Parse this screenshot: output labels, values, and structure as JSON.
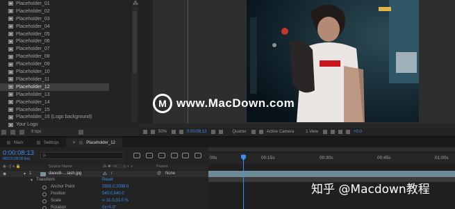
{
  "project": {
    "items": [
      "Placeholder_01",
      "Placeholder_02",
      "Placeholder_03",
      "Placeholder_04",
      "Placeholder_05",
      "Placeholder_06",
      "Placeholder_07",
      "Placeholder_08",
      "Placeholder_09",
      "Placeholder_10",
      "Placeholder_11",
      "Placeholder_12",
      "Placeholder_13",
      "Placeholder_14",
      "Placeholder_15",
      "Placeholder_16 (Logo background)",
      "Your Logo"
    ],
    "selected_index": 11,
    "bpc": "8 bpc",
    "flowchart_glyph": "⁂"
  },
  "viewer_footer": {
    "zoom": "50%",
    "timecode": "0:00:08:13",
    "resolution": "Quarter",
    "camera": "Active Camera",
    "view": "1 View",
    "exposure": "+0.0"
  },
  "timeline": {
    "tabs": [
      "Main",
      "Settings",
      "Placeholder_12"
    ],
    "active_tab": "Placeholder_12",
    "tab_close": "×",
    "timecode": "0:00:08:13",
    "frames": "00213 (25.00 fps)",
    "search_placeholder": "ρ.",
    "column_headers": {
      "source_name": "Source Name",
      "parent": "Parent"
    },
    "layer": {
      "index": "1",
      "name": "daoudi-....lash.jpg",
      "parent": "None"
    },
    "transform": {
      "label": "Transform",
      "reset": "Reset"
    },
    "properties": [
      {
        "name": "Anchor Point",
        "value": "2920.0,2008.0"
      },
      {
        "name": "Position",
        "value": "540.0,540.0"
      },
      {
        "name": "Scale",
        "value": "∞ 31.0,31.0 %"
      },
      {
        "name": "Rotation",
        "value": "0x+0.0°"
      }
    ],
    "ruler": [
      "00s",
      "00:15s",
      "00:30s",
      "00:45s",
      "01:00s"
    ]
  },
  "watermarks": {
    "site": "www.MacDown.com",
    "logo_letter": "M",
    "bottom": "知乎 @Macdown教程"
  },
  "colors": {
    "accent_blue": "#3d8df5",
    "layer_bar": "#6d8a96",
    "panel_bg": "#232323"
  }
}
